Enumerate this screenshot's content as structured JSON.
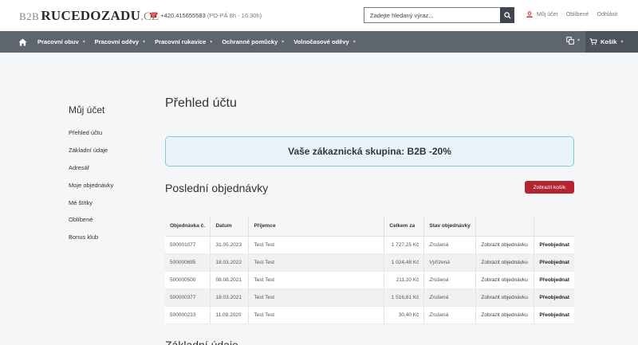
{
  "header": {
    "logo_prefix": "B2B",
    "logo_brand": "RUCEDOZADU",
    "logo_tld": ".CZ",
    "phone": "+420.415655583",
    "phone_hours": "(PO-PÁ 8h - 16:30h)",
    "search_placeholder": "Zadejte hledaný výraz...",
    "links": [
      "Můj účet",
      "Oblíbené",
      "Odhlásit"
    ]
  },
  "nav": {
    "items": [
      "Pracovní obuv",
      "Pracovní oděvy",
      "Pracovní rukavice",
      "Ochranné pomůcky",
      "Volnočasové oděvy"
    ],
    "cart_label": "Košík"
  },
  "sidebar": {
    "title": "Můj účet",
    "items": [
      "Přehled účtu",
      "Základní údaje",
      "Adresář",
      "Moje objednávky",
      "Mé štítky",
      "Oblíbené",
      "Bonus klub"
    ]
  },
  "main": {
    "title": "Přehled účtu",
    "group_text": "Vaše zákaznická skupina: B2B -20%",
    "orders_title": "Poslední objednávky",
    "cart_button": "Zobrazit košík",
    "next_title": "Základní údaje"
  },
  "orders": {
    "columns": [
      "Objednávka č.",
      "Datum",
      "Příjemce",
      "Celkem za",
      "Stav objednávky",
      "",
      ""
    ],
    "rows": [
      [
        "500001077",
        "31.05.2023",
        "Test Test",
        "1 727,25 Kč",
        "Zrušená",
        "Zobrazit objednávku",
        "Přeobjednat"
      ],
      [
        "500000695",
        "18.03.2022",
        "Test Test",
        "1 024,48 Kč",
        "Vyřízená",
        "Zobrazit objednávku",
        "Přeobjednat"
      ],
      [
        "500000500",
        "08.08.2021",
        "Test Test",
        "211,20 Kč",
        "Zrušená",
        "Zobrazit objednávku",
        "Přeobjednat"
      ],
      [
        "500000377",
        "18.03.2021",
        "Test Test",
        "1 516,81 Kč",
        "Zrušená",
        "Zobrazit objednávku",
        "Přeobjednat"
      ],
      [
        "500000233",
        "11.09.2020",
        "Test Test",
        "30,40 Kč",
        "Zrušená",
        "Zobrazit objednávku",
        "Přeobjednat"
      ]
    ]
  },
  "colors": {
    "nav_bg": "#5f656e",
    "accent_red": "#b22531",
    "info_box_bg": "#e9f4fa",
    "info_box_border": "#8cc6d8"
  },
  "icons": {
    "home": "home-icon",
    "search": "search-icon",
    "user": "user-icon",
    "phone": "phone-icon",
    "compare": "compare-icon",
    "cart": "cart-icon"
  }
}
